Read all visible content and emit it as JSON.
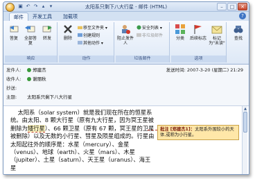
{
  "title": "太阳系只剩下八大行星 - 邮件 (HTML)",
  "tabs": [
    "邮件",
    "开发工具",
    "加载项"
  ],
  "ribbon": {
    "respond": {
      "label": "响应",
      "reply": "答复",
      "reply_all": "全部答复",
      "forward": "转发"
    },
    "actions": {
      "label": "动作",
      "delete": "删除",
      "move_to_folder": "移至文件夹",
      "create_rule": "创建规则",
      "other_actions": "其他动作"
    },
    "junk": {
      "label": "垃圾邮件",
      "block_sender": "阻止发件人",
      "safe_list": "安全列表",
      "not_junk": "非垃圾邮件"
    },
    "options": {
      "label": "选项",
      "categorize": "分类",
      "follow_up": "后续标志",
      "mark_unread": "标记为\"未读\""
    },
    "find": {
      "label": "查找"
    }
  },
  "header": {
    "from_label": "发件人:",
    "from": "郑建杰",
    "to_label": "收件人:",
    "to": "谢丽秋",
    "cc_label": "抄送:",
    "cc": "",
    "subject_label": "主题:",
    "subject": "太阳系只剩下八大行星",
    "sent_label": "发送时间:",
    "sent": "2007-3-20 (星期二) 21:29"
  },
  "body": {
    "text_before": "    太阳系（solar system）就是我们现在所在的恒星系统。由太阳、8 颗大行星（原有九大行星，因为冥王星被删除为",
    "highlight": "矮行星",
    "text_after": "）、66 颗卫星（原有 67 颗，冥王星的卫星被删除）以及无数的小行星、彗星及陨星组成的。行星由太阳起往外的顺序是：水星（mercury）、金星（venus）、地球（earth）、火星（mars）、木星（jupiter）、土星（saturn）、天王星（uranus）、海王星"
  },
  "comment": {
    "prefix": "批注 [郑建杰1]：",
    "text": "太阳系外围较小的天体,或称为小行星。"
  },
  "colors": {
    "accent": "#2f5ea6",
    "comment_bg": "#ffe7a8",
    "highlight_border": "#c0392b"
  }
}
